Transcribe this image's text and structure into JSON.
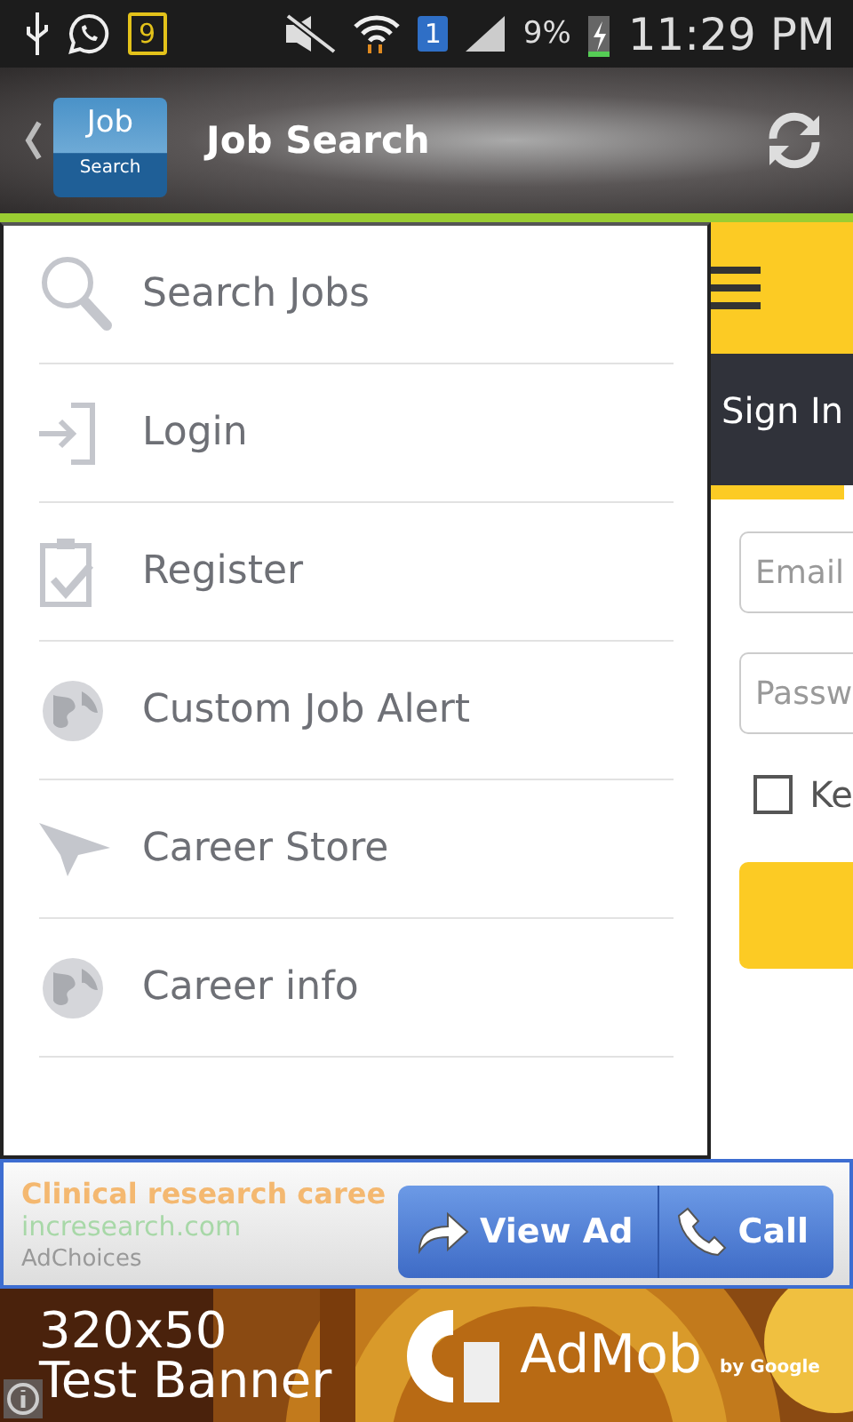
{
  "status_bar": {
    "notification_count": "9",
    "sim_badge": "1",
    "battery": "9%",
    "time": "11:29 PM"
  },
  "app_bar": {
    "logo_top": "Job",
    "logo_bottom": "Search",
    "title": "Job Search"
  },
  "drawer": {
    "items": [
      {
        "label": "Search Jobs",
        "kind": "search"
      },
      {
        "label": "Login",
        "kind": "login"
      },
      {
        "label": "Register",
        "kind": "clipboard"
      },
      {
        "label": "Custom Job Alert",
        "kind": "globe"
      },
      {
        "label": "Career Store",
        "kind": "plane"
      },
      {
        "label": "Career info",
        "kind": "globe"
      }
    ]
  },
  "page": {
    "tab": {
      "label": "Sign In",
      "selected": true
    },
    "email_placeholder": "Email",
    "password_placeholder": "Passw",
    "remember": {
      "label": "Ke",
      "checked": false
    }
  },
  "ad": {
    "headline": "Clinical research caree",
    "domain": "incresearch.com",
    "choices": "AdChoices",
    "buttons": [
      {
        "label": "View Ad",
        "kind": "arrow"
      },
      {
        "label": "Call",
        "kind": "phone"
      }
    ]
  },
  "banner": {
    "line1": "320x50",
    "line2": "Test Banner",
    "brand": "AdMob",
    "by": "by Google"
  }
}
